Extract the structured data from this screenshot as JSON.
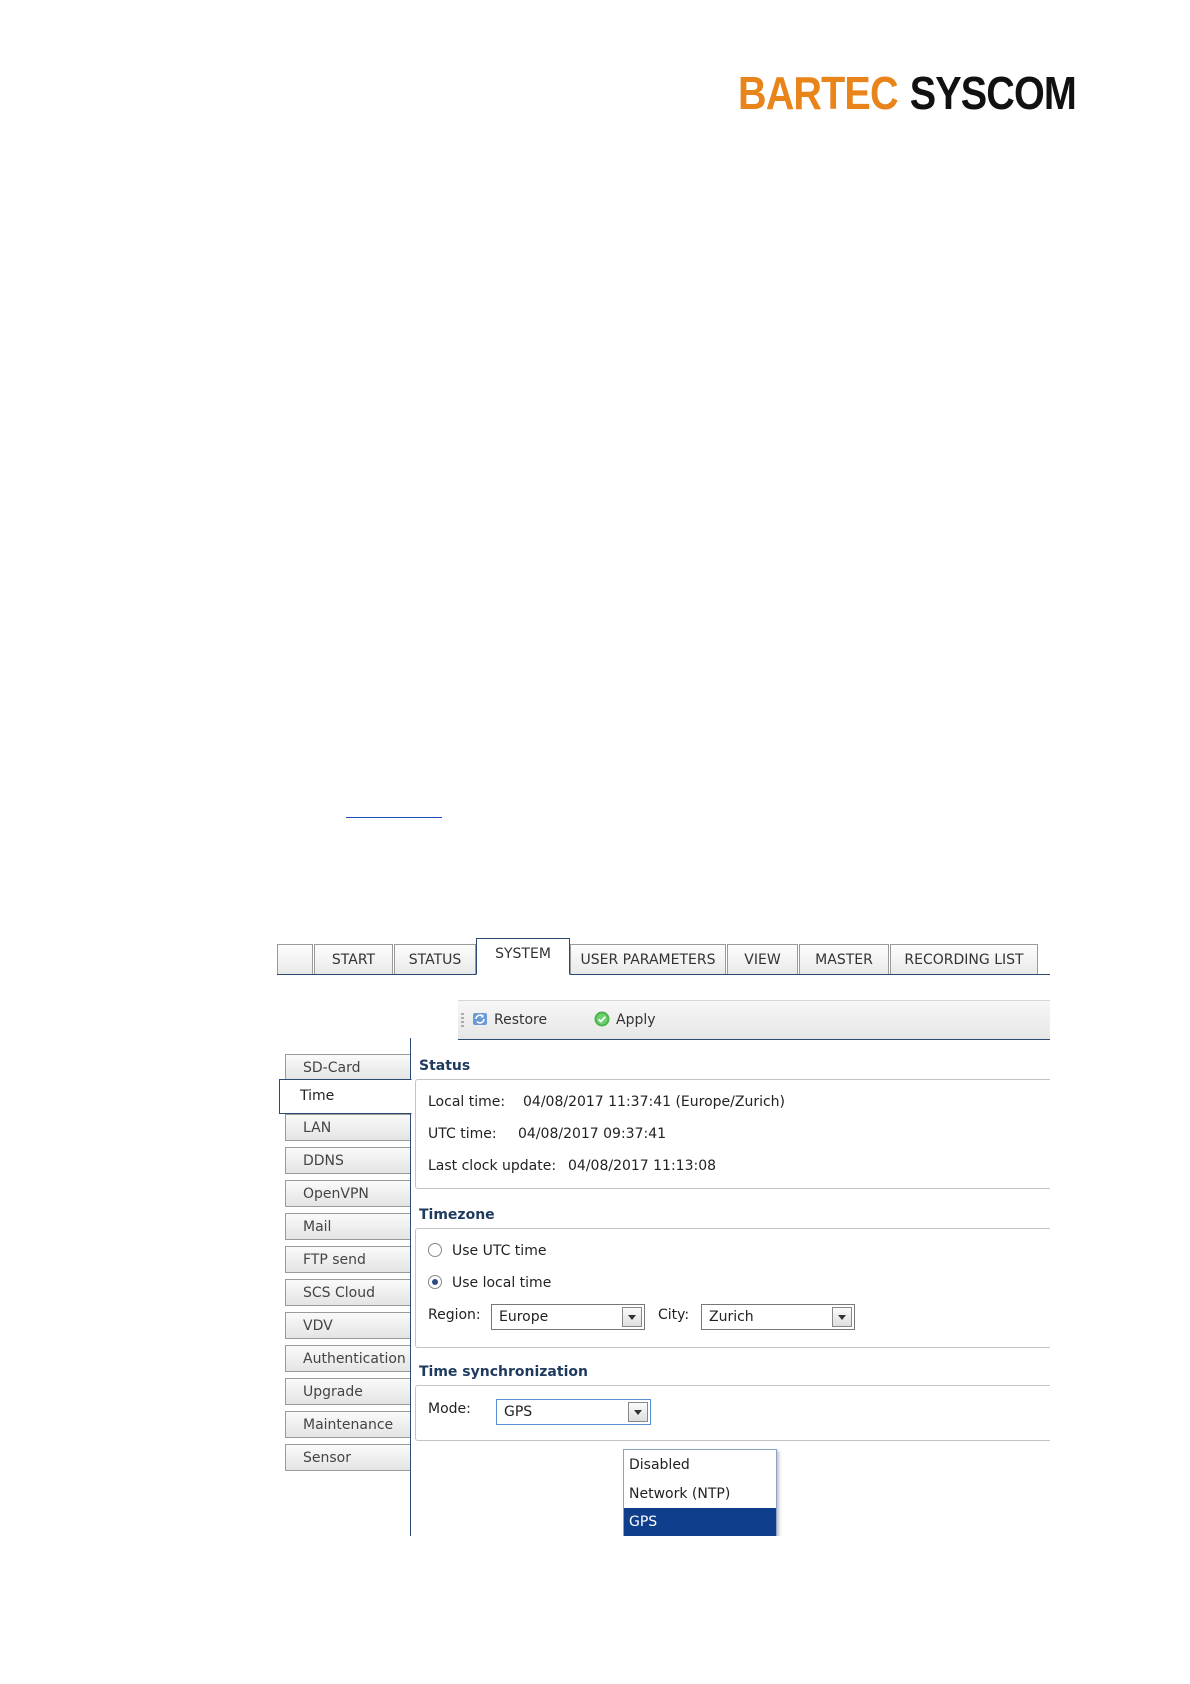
{
  "logo": {
    "part1": "BARTEC",
    "part2": "SYSCOM"
  },
  "top_tabs": [
    {
      "label": ""
    },
    {
      "label": "START"
    },
    {
      "label": "STATUS"
    },
    {
      "label": "SYSTEM"
    },
    {
      "label": "USER PARAMETERS"
    },
    {
      "label": "VIEW"
    },
    {
      "label": "MASTER"
    },
    {
      "label": "RECORDING LIST"
    }
  ],
  "toolbar": {
    "restore_label": "Restore",
    "apply_label": "Apply"
  },
  "sidebar": {
    "items": [
      {
        "label": "SD-Card"
      },
      {
        "label": "Time"
      },
      {
        "label": "LAN"
      },
      {
        "label": "DDNS"
      },
      {
        "label": "OpenVPN"
      },
      {
        "label": "Mail"
      },
      {
        "label": "FTP send"
      },
      {
        "label": "SCS Cloud"
      },
      {
        "label": "VDV"
      },
      {
        "label": "Authentication"
      },
      {
        "label": "Upgrade"
      },
      {
        "label": "Maintenance"
      },
      {
        "label": "Sensor"
      }
    ],
    "active": "Time"
  },
  "status": {
    "title": "Status",
    "local_time_label": "Local time:",
    "local_time_value": "04/08/2017 11:37:41 (Europe/Zurich)",
    "utc_time_label": "UTC time:",
    "utc_time_value": "04/08/2017 09:37:41",
    "last_update_label": "Last clock update:",
    "last_update_value": "04/08/2017 11:13:08"
  },
  "timezone": {
    "title": "Timezone",
    "use_utc_label": "Use UTC time",
    "use_local_label": "Use local time",
    "selected": "local",
    "region_label": "Region:",
    "region_value": "Europe",
    "city_label": "City:",
    "city_value": "Zurich"
  },
  "time_sync": {
    "title": "Time synchronization",
    "mode_label": "Mode:",
    "mode_value": "GPS",
    "options": [
      "Disabled",
      "Network (NTP)",
      "GPS"
    ],
    "selected_option": "GPS"
  },
  "colors": {
    "brand_orange": "#e8841a",
    "selection_blue": "#0f3f8c",
    "frame_blue": "#2c4a73"
  }
}
